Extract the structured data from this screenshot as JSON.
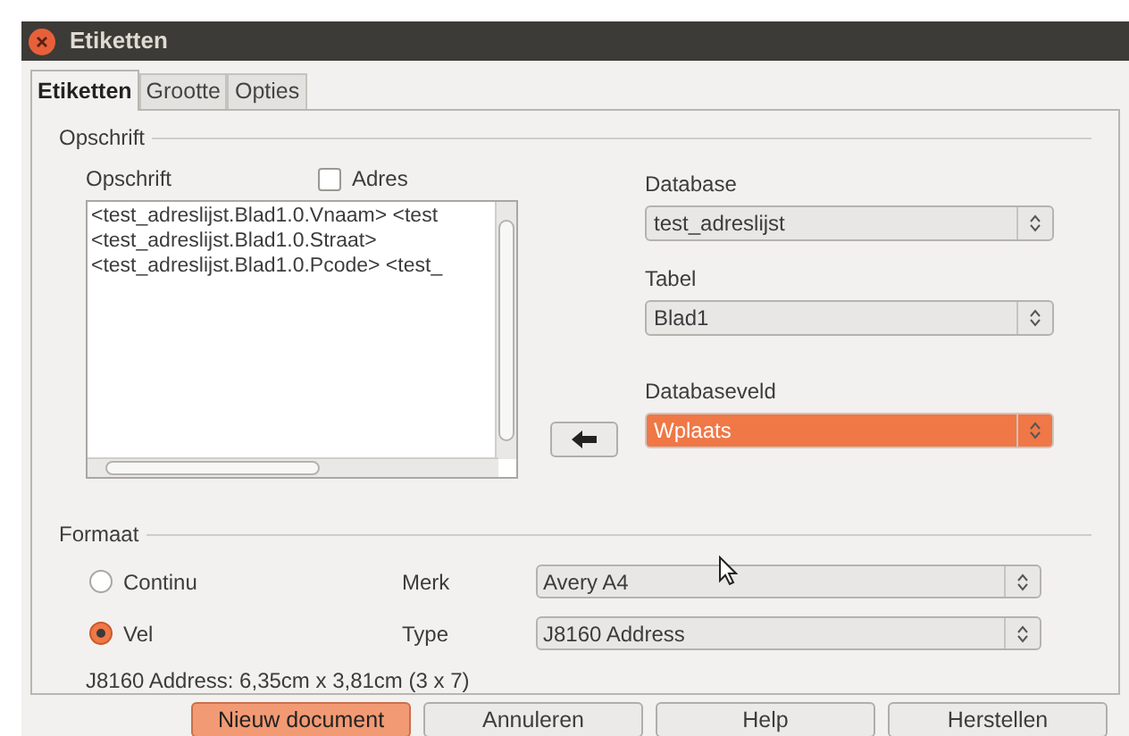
{
  "window": {
    "title": "Etiketten"
  },
  "tabs": [
    {
      "label": "Etiketten",
      "selected": true
    },
    {
      "label": "Grootte",
      "selected": false
    },
    {
      "label": "Opties",
      "selected": false
    }
  ],
  "opschrift_group": {
    "title": "Opschrift",
    "label": "Opschrift",
    "address_checkbox": {
      "label": "Adres",
      "checked": false
    },
    "text_lines": [
      "<test_adreslijst.Blad1.0.Vnaam> <test",
      "<test_adreslijst.Blad1.0.Straat>",
      "<test_adreslijst.Blad1.0.Pcode> <test_"
    ],
    "fields": [
      {
        "label": "Database",
        "value": "test_adreslijst",
        "highlighted": false
      },
      {
        "label": "Tabel",
        "value": "Blad1",
        "highlighted": false
      },
      {
        "label": "Databaseveld",
        "value": "Wplaats",
        "highlighted": true
      }
    ]
  },
  "formaat_group": {
    "title": "Formaat",
    "options": [
      {
        "label": "Continu",
        "selected": false
      },
      {
        "label": "Vel",
        "selected": true
      }
    ],
    "selects": [
      {
        "label": "Merk",
        "value": "Avery A4"
      },
      {
        "label": "Type",
        "value": "J8160 Address"
      }
    ],
    "info": "J8160 Address: 6,35cm x 3,81cm (3 x 7)"
  },
  "buttons": [
    {
      "label": "Nieuw document",
      "default": true
    },
    {
      "label": "Annuleren",
      "default": false
    },
    {
      "label": "Help",
      "default": false
    },
    {
      "label": "Herstellen",
      "default": false
    }
  ]
}
